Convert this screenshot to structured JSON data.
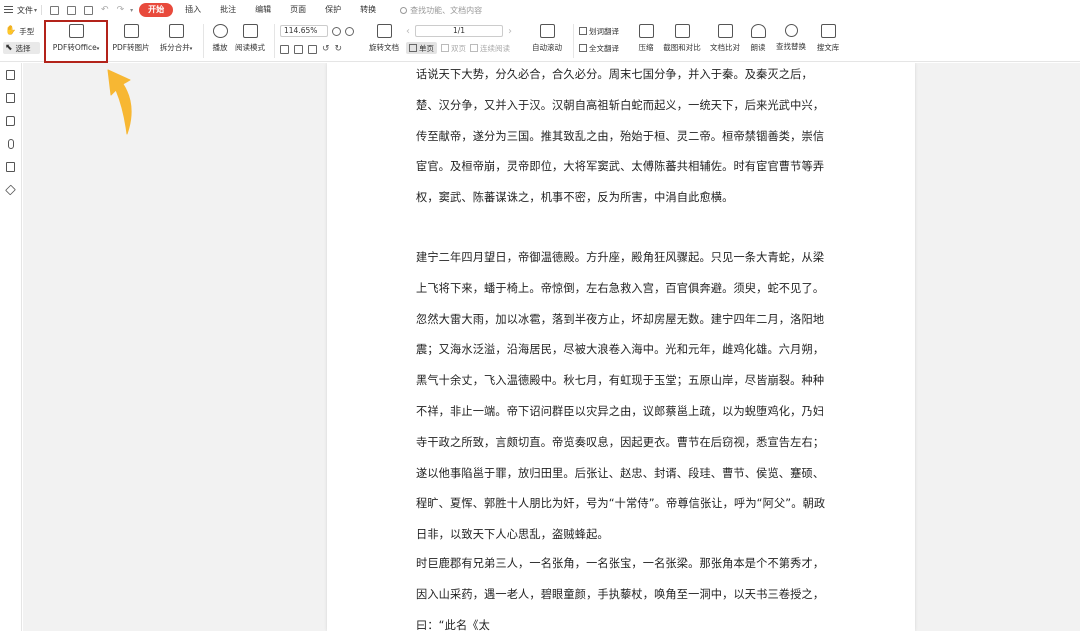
{
  "menubar": {
    "file_label": "文件",
    "tabs": [
      {
        "label": "开始",
        "active": true
      },
      {
        "label": "插入",
        "active": false
      },
      {
        "label": "批注",
        "active": false
      },
      {
        "label": "编辑",
        "active": false
      },
      {
        "label": "页面",
        "active": false
      },
      {
        "label": "保护",
        "active": false
      },
      {
        "label": "转换",
        "active": false
      }
    ],
    "search_placeholder": "查找功能、文档内容"
  },
  "ribbon": {
    "hand_label": "手型",
    "select_label": "选择",
    "pdf_to_office": "PDF转Office",
    "pdf_to_image": "PDF转图片",
    "split_merge": "拆分合并",
    "play": "播放",
    "read_mode": "阅读模式",
    "zoom_value": "114.65%",
    "page_indicator": "1/1",
    "rotate_doc": "旋转文档",
    "single_page": "单页",
    "double_page": "双页",
    "continuous_read": "连续阅读",
    "auto_scroll": "自动滚动",
    "word_translate": "划词翻译",
    "full_translate": "全文翻译",
    "compress": "压缩",
    "screenshot_compare": "截图和对比",
    "doc_compare": "文档比对",
    "read_aloud": "朗读",
    "find_replace": "查找替换",
    "doc_library": "搜文库"
  },
  "colors": {
    "accent_tab": "#e84a3c",
    "highlight_box": "#b3231a",
    "arrow": "#f7b733"
  },
  "document": {
    "paragraphs": [
      "话说天下大势，分久必合，合久必分。周末七国分争，并入于秦。及秦灭之后，楚、汉分争，又并入于汉。汉朝自高祖斩白蛇而起义，一统天下，后来光武中兴，传至献帝，遂分为三国。推其致乱之由，殆始于桓、灵二帝。桓帝禁锢善类，崇信宦官。及桓帝崩，灵帝即位，大将军窦武、太傅陈蕃共相辅佐。时有宦官曹节等弄权，窦武、陈蕃谋诛之，机事不密，反为所害，中涓自此愈横。",
      "建宁二年四月望日，帝御温德殿。方升座，殿角狂风骤起。只见一条大青蛇，从梁上飞将下来，蟠于椅上。帝惊倒，左右急救入宫，百官俱奔避。须臾，蛇不见了。忽然大雷大雨，加以冰雹，落到半夜方止，坏却房屋无数。建宁四年二月，洛阳地震；又海水泛溢，沿海居民，尽被大浪卷入海中。光和元年，雌鸡化雄。六月朔，黑气十余丈，飞入温德殿中。秋七月，有虹现于玉堂；五原山岸，尽皆崩裂。种种不祥，非止一端。帝下诏问群臣以灾异之由，议郎蔡邕上疏，以为蜺堕鸡化，乃妇寺干政之所致，言颇切直。帝览奏叹息，因起更衣。曹节在后窃视，悉宣告左右；遂以他事陷邕于罪，放归田里。后张让、赵忠、封谞、段珪、曹节、侯览、蹇硕、程旷、夏恽、郭胜十人朋比为奸，号为“十常侍”。帝尊信张让，呼为“阿父”。朝政日非，以致天下人心思乱，盗贼蜂起。",
      "时巨鹿郡有兄弟三人，一名张角，一名张宝，一名张梁。那张角本是个不第秀才，因入山采药，遇一老人，碧眼童颜，手执藜杖，唤角至一洞中，以天书三卷授之，曰：“此名《太"
    ]
  }
}
